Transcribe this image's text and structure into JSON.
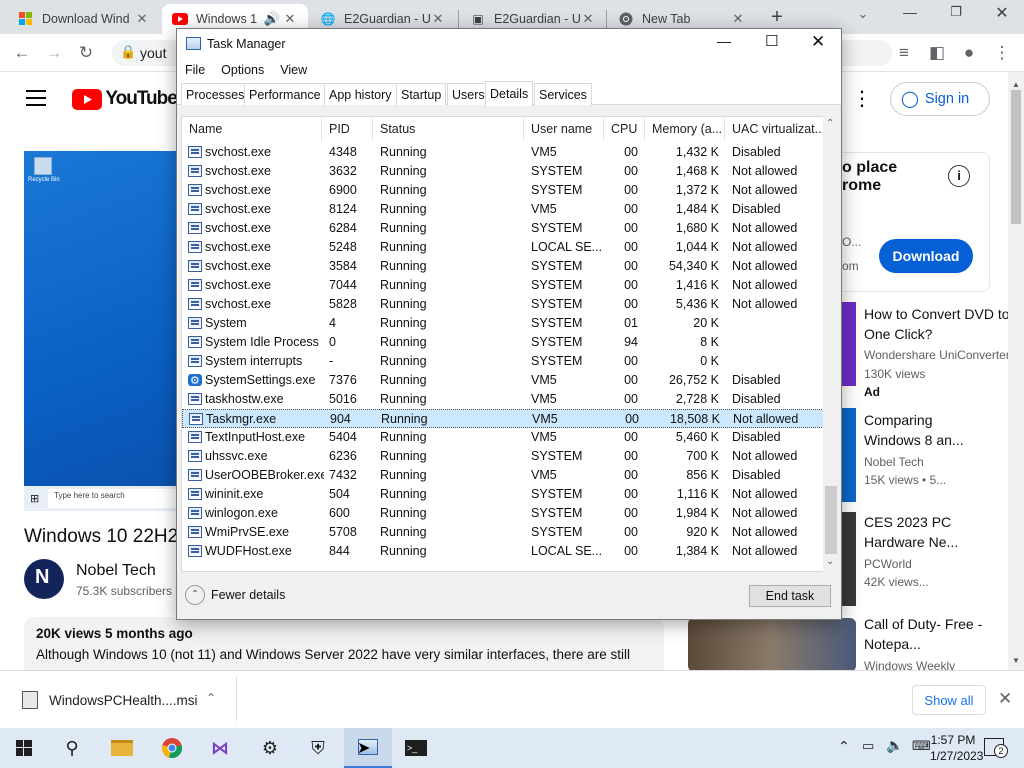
{
  "browser": {
    "tabs": [
      {
        "title": "Download Wind",
        "icon": "windows-logo-icon",
        "active": false
      },
      {
        "title": "Windows 1",
        "icon": "youtube-icon",
        "active": true
      },
      {
        "title": "E2Guardian - U",
        "icon": "globe-icon",
        "active": false
      },
      {
        "title": "E2Guardian - U",
        "icon": "image-icon",
        "active": false
      },
      {
        "title": "New Tab",
        "icon": "chrome-icon",
        "active": false
      }
    ],
    "url": "yout"
  },
  "youtube": {
    "logo_text": "YouTube",
    "sign_in": "Sign in",
    "video_title": "Windows 10 22H2",
    "channel_name": "Nobel Tech",
    "subscribers": "75.3K subscribers",
    "taskbar_search_hint": "Type here to search",
    "recycle_bin": "Recycle Bin",
    "meta": "20K views  5 months ago",
    "description": "Although Windows 10 (not 11) and Windows Server 2022 have very similar interfaces, there are still",
    "ad_title_line1": "o place",
    "ad_title_line2": "rome",
    "ad_line": "O...",
    "ad_domain": "om",
    "download_btn": "Download",
    "recommendations": [
      {
        "title": "How to Convert DVD to One Click?",
        "channel": "Wondershare UniConverter",
        "stats": "130K views",
        "badge": "Ad"
      },
      {
        "title": "Comparing Windows 8 an...",
        "channel": "Nobel Tech",
        "stats": "15K views • 5..."
      },
      {
        "title": "CES 2023 PC Hardware Ne...",
        "channel": "PCWorld",
        "stats": "42K views..."
      },
      {
        "title": "Call of Duty- Free - Notepa...",
        "channel": "Windows Weekly",
        "stats": ""
      }
    ]
  },
  "taskmanager": {
    "title": "Task Manager",
    "menu": [
      "File",
      "Options",
      "View"
    ],
    "tabs": [
      "Processes",
      "Performance",
      "App history",
      "Startup",
      "Users",
      "Details",
      "Services"
    ],
    "active_tab": "Details",
    "columns": [
      "Name",
      "PID",
      "Status",
      "User name",
      "CPU",
      "Memory (a...",
      "UAC virtualizat..."
    ],
    "rows": [
      {
        "name": "svchost.exe",
        "pid": "4348",
        "status": "Running",
        "user": "VM5",
        "cpu": "00",
        "mem": "1,432 K",
        "uac": "Disabled"
      },
      {
        "name": "svchost.exe",
        "pid": "3632",
        "status": "Running",
        "user": "SYSTEM",
        "cpu": "00",
        "mem": "1,468 K",
        "uac": "Not allowed"
      },
      {
        "name": "svchost.exe",
        "pid": "6900",
        "status": "Running",
        "user": "SYSTEM",
        "cpu": "00",
        "mem": "1,372 K",
        "uac": "Not allowed"
      },
      {
        "name": "svchost.exe",
        "pid": "8124",
        "status": "Running",
        "user": "VM5",
        "cpu": "00",
        "mem": "1,484 K",
        "uac": "Disabled"
      },
      {
        "name": "svchost.exe",
        "pid": "6284",
        "status": "Running",
        "user": "SYSTEM",
        "cpu": "00",
        "mem": "1,680 K",
        "uac": "Not allowed"
      },
      {
        "name": "svchost.exe",
        "pid": "5248",
        "status": "Running",
        "user": "LOCAL SE...",
        "cpu": "00",
        "mem": "1,044 K",
        "uac": "Not allowed"
      },
      {
        "name": "svchost.exe",
        "pid": "3584",
        "status": "Running",
        "user": "SYSTEM",
        "cpu": "00",
        "mem": "54,340 K",
        "uac": "Not allowed"
      },
      {
        "name": "svchost.exe",
        "pid": "7044",
        "status": "Running",
        "user": "SYSTEM",
        "cpu": "00",
        "mem": "1,416 K",
        "uac": "Not allowed"
      },
      {
        "name": "svchost.exe",
        "pid": "5828",
        "status": "Running",
        "user": "SYSTEM",
        "cpu": "00",
        "mem": "5,436 K",
        "uac": "Not allowed"
      },
      {
        "name": "System",
        "pid": "4",
        "status": "Running",
        "user": "SYSTEM",
        "cpu": "01",
        "mem": "20 K",
        "uac": ""
      },
      {
        "name": "System Idle Process",
        "pid": "0",
        "status": "Running",
        "user": "SYSTEM",
        "cpu": "94",
        "mem": "8 K",
        "uac": ""
      },
      {
        "name": "System interrupts",
        "pid": "-",
        "status": "Running",
        "user": "SYSTEM",
        "cpu": "00",
        "mem": "0 K",
        "uac": ""
      },
      {
        "name": "SystemSettings.exe",
        "pid": "7376",
        "status": "Running",
        "user": "VM5",
        "cpu": "00",
        "mem": "26,752 K",
        "uac": "Disabled",
        "icon": "gear"
      },
      {
        "name": "taskhostw.exe",
        "pid": "5016",
        "status": "Running",
        "user": "VM5",
        "cpu": "00",
        "mem": "2,728 K",
        "uac": "Disabled"
      },
      {
        "name": "Taskmgr.exe",
        "pid": "904",
        "status": "Running",
        "user": "VM5",
        "cpu": "00",
        "mem": "18,508 K",
        "uac": "Not allowed",
        "selected": true
      },
      {
        "name": "TextInputHost.exe",
        "pid": "5404",
        "status": "Running",
        "user": "VM5",
        "cpu": "00",
        "mem": "5,460 K",
        "uac": "Disabled"
      },
      {
        "name": "uhssvc.exe",
        "pid": "6236",
        "status": "Running",
        "user": "SYSTEM",
        "cpu": "00",
        "mem": "700 K",
        "uac": "Not allowed"
      },
      {
        "name": "UserOOBEBroker.exe",
        "pid": "7432",
        "status": "Running",
        "user": "VM5",
        "cpu": "00",
        "mem": "856 K",
        "uac": "Disabled"
      },
      {
        "name": "wininit.exe",
        "pid": "504",
        "status": "Running",
        "user": "SYSTEM",
        "cpu": "00",
        "mem": "1,116 K",
        "uac": "Not allowed"
      },
      {
        "name": "winlogon.exe",
        "pid": "600",
        "status": "Running",
        "user": "SYSTEM",
        "cpu": "00",
        "mem": "1,984 K",
        "uac": "Not allowed"
      },
      {
        "name": "WmiPrvSE.exe",
        "pid": "5708",
        "status": "Running",
        "user": "SYSTEM",
        "cpu": "00",
        "mem": "920 K",
        "uac": "Not allowed"
      },
      {
        "name": "WUDFHost.exe",
        "pid": "844",
        "status": "Running",
        "user": "LOCAL SE...",
        "cpu": "00",
        "mem": "1,384 K",
        "uac": "Not allowed"
      }
    ],
    "fewer_details": "Fewer details",
    "end_task": "End task"
  },
  "downloads": {
    "file": "WindowsPCHealth....msi",
    "show_all": "Show all"
  },
  "taskbar": {
    "time": "1:57 PM",
    "date": "1/27/2023",
    "notif_count": "2"
  },
  "colors": {
    "youtube_red": "#ff0000",
    "accent_blue": "#065fd4",
    "selection": "#cce8ff",
    "taskbar": "#dfe9f5"
  }
}
